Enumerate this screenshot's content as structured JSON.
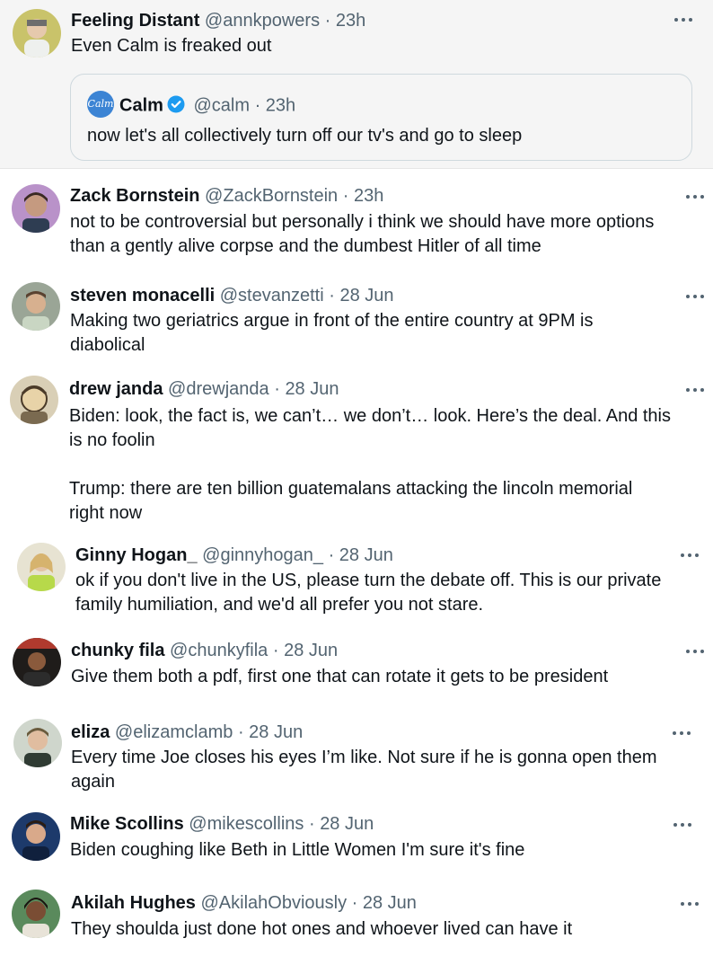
{
  "tweets": [
    {
      "name": "Feeling Distant",
      "handle": "@annkpowers",
      "sep": "·",
      "time": "23h",
      "lines": [
        "Even Calm is freaked out"
      ],
      "quote": {
        "name": "Calm",
        "logo": "Calm",
        "handle": "@calm",
        "sep": "·",
        "time": "23h",
        "text": "now let's all collectively turn off our tv's and go to sleep"
      }
    },
    {
      "name": "Zack Bornstein",
      "handle": "@ZackBornstein",
      "sep": "·",
      "time": "23h",
      "lines": [
        "not to be controversial but personally i think we should have more options",
        "than a gently alive corpse and the dumbest Hitler of all time"
      ]
    },
    {
      "name": "steven monacelli",
      "handle": "@stevanzetti",
      "sep": "·",
      "time": "28 Jun",
      "lines": [
        "Making two geriatrics argue in front of the entire country at 9PM is",
        "diabolical"
      ]
    },
    {
      "name": "drew janda",
      "handle": "@drewjanda",
      "sep": "·",
      "time": "28 Jun",
      "lines": [
        "Biden: look, the fact is, we can’t… we don’t… look. Here’s the deal. And this",
        "is no foolin",
        "",
        "Trump: there are ten billion guatemalans attacking the lincoln memorial",
        "right now"
      ]
    },
    {
      "name": "Ginny Hogan_",
      "handle": "@ginnyhogan_",
      "sep": "·",
      "time": "28 Jun",
      "lines": [
        "ok if you don't live in the US, please turn the debate off. This is our private",
        "family humiliation, and we'd all prefer you not stare."
      ]
    },
    {
      "name": "chunky fila",
      "handle": "@chunkyfila",
      "sep": "·",
      "time": "28 Jun",
      "lines": [
        "Give them both a pdf, first one that can rotate it gets to be president"
      ]
    },
    {
      "name": "eliza",
      "handle": "@elizamclamb",
      "sep": "·",
      "time": "28 Jun",
      "lines": [
        "Every time Joe closes his eyes I’m like. Not sure if he is gonna open them",
        "again"
      ]
    },
    {
      "name": "Mike Scollins",
      "handle": "@mikescollins",
      "sep": "·",
      "time": "28 Jun",
      "lines": [
        "Biden coughing like Beth in Little Women I'm sure it's fine"
      ]
    },
    {
      "name": "Akilah Hughes",
      "handle": "@AkilahObviously",
      "sep": "·",
      "time": "28 Jun",
      "lines": [
        "They shoulda just done hot ones and whoever lived can have it"
      ]
    }
  ],
  "icons": {
    "more": "more-options-icon",
    "verified": "verified-badge-icon"
  },
  "colors": {
    "secondary_text": "#536471",
    "verified_blue": "#1d9bf0",
    "quote_bg": "#f5f5f5"
  }
}
